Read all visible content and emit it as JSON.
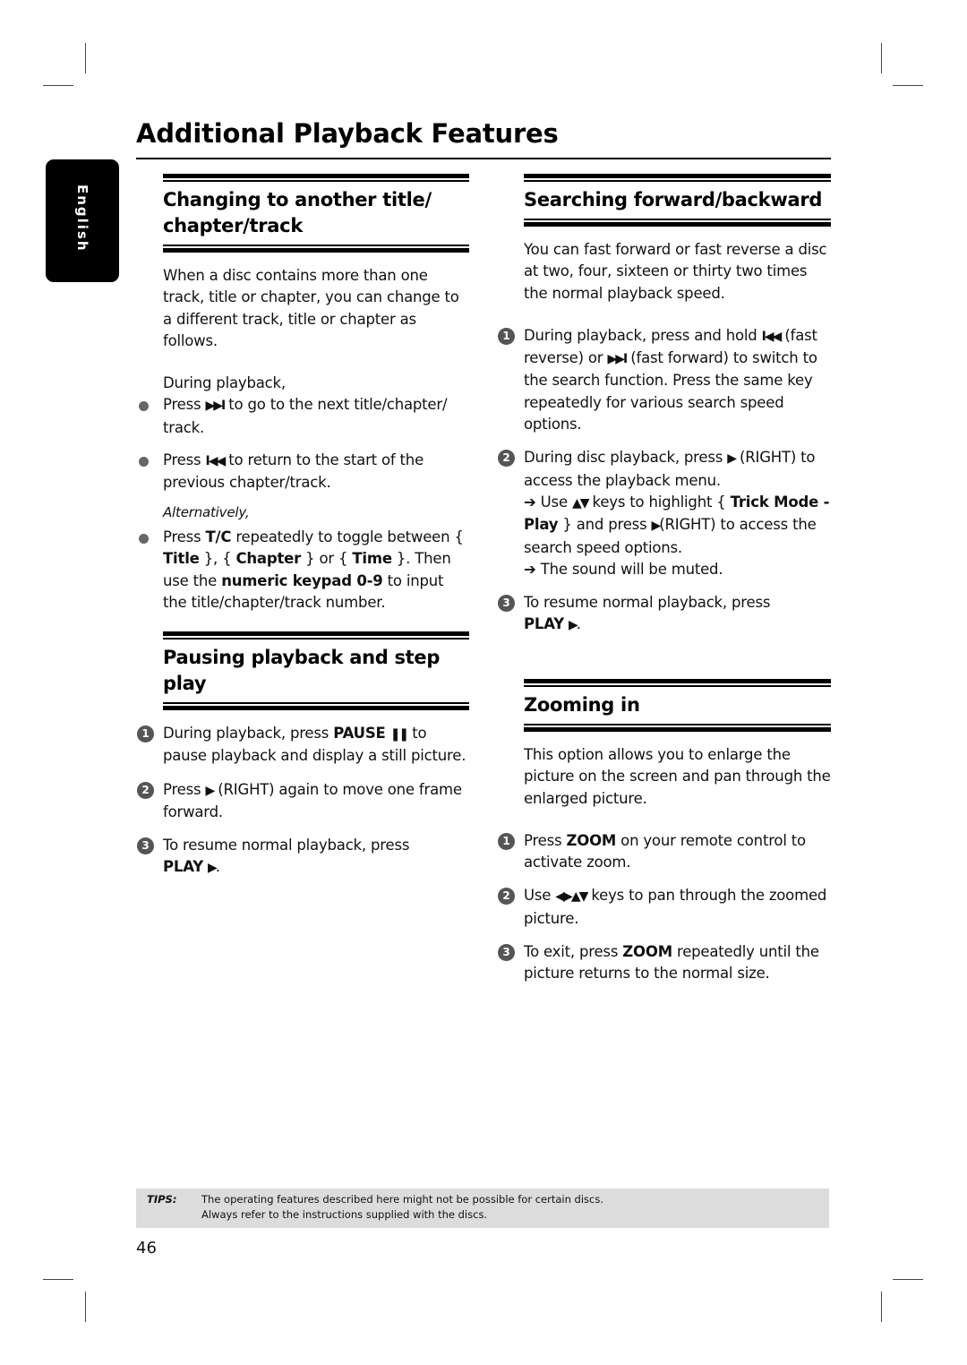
{
  "page": {
    "title": "Additional Playback Features",
    "language_tab": "English",
    "page_number": "46"
  },
  "sections": {
    "changing": {
      "heading_line1": "Changing to another title/",
      "heading_line2": "chapter/track",
      "intro": "When a disc contains more than one track, title or chapter, you can change to a different track, title or chapter as follows.",
      "during": "During playback,",
      "bullet1_pre": "Press ",
      "bullet1_icon": "next-icon",
      "bullet1_post": " to go to the next title/chapter/ track.",
      "bullet2_pre": "Press ",
      "bullet2_icon": "previous-icon",
      "bullet2_post": " to return to the start of the previous chapter/track.",
      "alternatively": "Alternatively,",
      "bullet3_a": "Press ",
      "bullet3_b": "T/C",
      "bullet3_c": " repeatedly to toggle between { ",
      "bullet3_d": "Title",
      "bullet3_e": " }, { ",
      "bullet3_f": "Chapter",
      "bullet3_g": " } or { ",
      "bullet3_h": "Time",
      "bullet3_i": " }. Then use the ",
      "bullet3_j": "numeric keypad 0-9",
      "bullet3_k": " to input the title/chapter/track number."
    },
    "pausing": {
      "heading_line1": "Pausing playback and step",
      "heading_line2": "play",
      "step1_a": "During playback, press ",
      "step1_b": "PAUSE",
      "step1_icon": "pause-icon",
      "step1_c": " to pause playback and display a still picture.",
      "step2_a": "Press ",
      "step2_icon": "right-arrow-icon",
      "step2_b": " (RIGHT) again to move one frame forward.",
      "step3_a": "To resume normal playback, press ",
      "step3_b": "PLAY",
      "step3_icon": "play-icon",
      "step3_c": "."
    },
    "searching": {
      "heading": "Searching forward/backward",
      "intro": "You can fast forward or fast reverse a disc at two, four, sixteen or thirty two times the normal playback speed.",
      "step1_a": "During playback, press and hold ",
      "step1_icon1": "previous-icon",
      "step1_b": " (fast reverse) or ",
      "step1_icon2": "next-icon",
      "step1_c": " (fast forward) to switch to the search function. Press the same key repeatedly for various search speed options.",
      "step2_a": "During disc playback, press ",
      "step2_icon": "right-arrow-icon",
      "step2_b": " (RIGHT) to access the playback menu.",
      "step2_r1_a": " Use ",
      "step2_r1_icon": "up-down-arrows-icon",
      "step2_r1_b": " keys to highlight { ",
      "step2_r1_c": "Trick Mode - Play",
      "step2_r1_d": " } and press ",
      "step2_r1_icon2": "right-arrow-icon",
      "step2_r1_e": "(RIGHT) to access the search speed options.",
      "step2_r2": " The sound will be muted.",
      "step3_a": "To resume normal playback, press ",
      "step3_b": "PLAY",
      "step3_icon": "play-icon",
      "step3_c": "."
    },
    "zooming": {
      "heading": "Zooming in",
      "intro": "This option allows you to enlarge the picture on the screen and pan through the enlarged picture.",
      "step1_a": "Press ",
      "step1_b": "ZOOM",
      "step1_c": " on your remote control to activate zoom.",
      "step2_a": "Use ",
      "step2_icon": "four-way-arrows-icon",
      "step2_b": " keys to pan through the zoomed picture.",
      "step3_a": "To exit, press ",
      "step3_b": "ZOOM",
      "step3_c": " repeatedly until the picture returns to the normal size."
    }
  },
  "symbols": {
    "next": "▶▶I",
    "previous": "I◀◀",
    "pause": "❚❚",
    "play": "▶",
    "updown": "▲▼",
    "fourway": "◀▶▲▼",
    "result_arrow": "➔",
    "num1": "1",
    "num2": "2",
    "num3": "3"
  },
  "tips": {
    "label": "TIPS:",
    "line1": "The operating features described here might not be possible for certain discs.",
    "line2": "Always refer to the instructions supplied with the discs."
  }
}
